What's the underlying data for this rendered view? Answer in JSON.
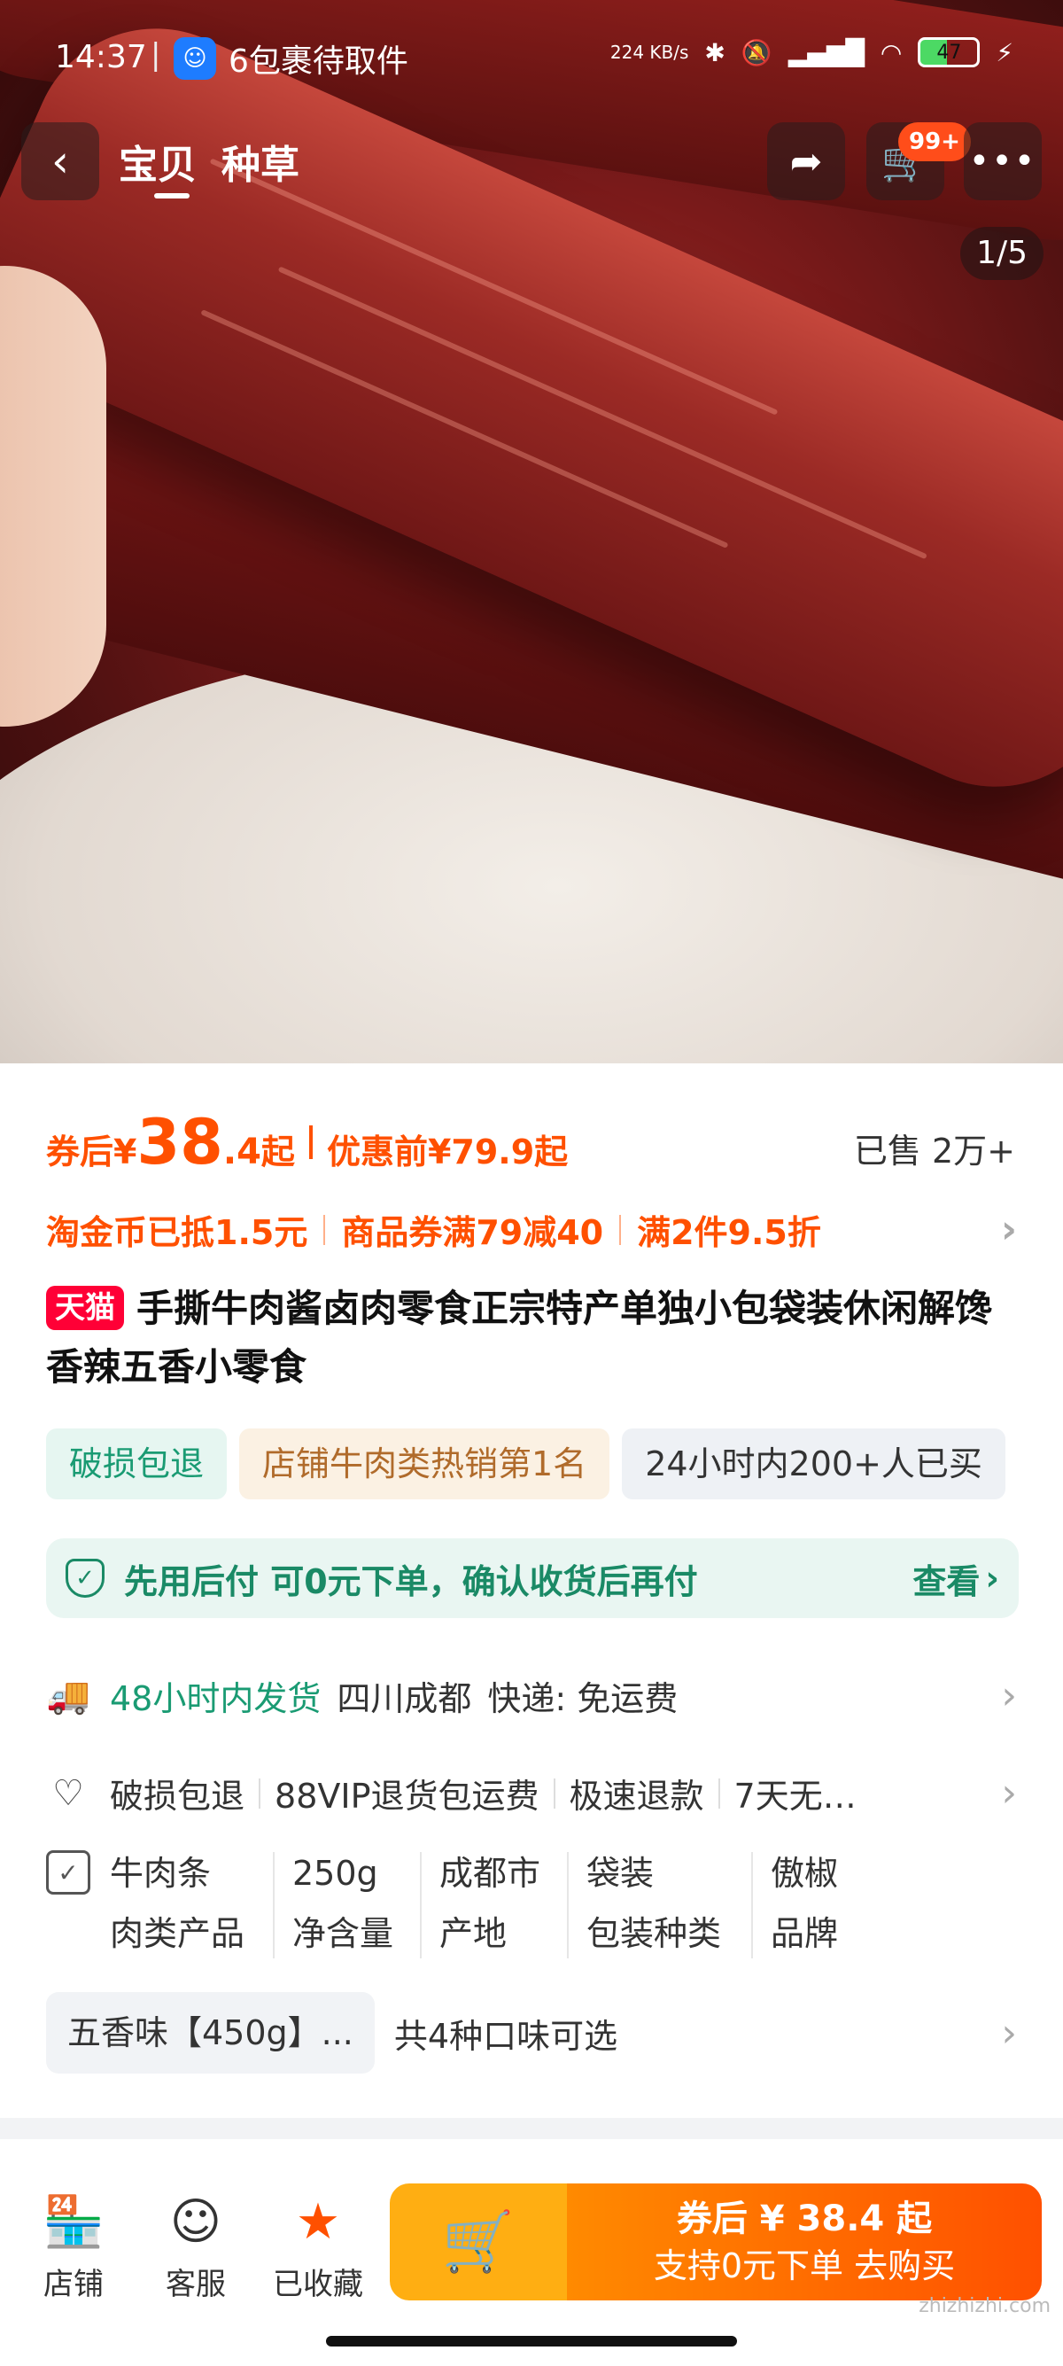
{
  "status_bar": {
    "time": "14:37",
    "notification": "6包裹待取件",
    "net_speed": "224 KB/s",
    "battery": "47"
  },
  "nav": {
    "tabs": [
      "宝贝",
      "种草"
    ],
    "cart_badge": "99+",
    "image_counter": "1/5"
  },
  "price": {
    "prefix": "券后",
    "currency": "¥",
    "amount_int": "38",
    "amount_dec": ".4",
    "suffix": "起",
    "before_label": "优惠前",
    "before_price": "¥79.9",
    "before_suffix": "起",
    "sold": "已售 2万+"
  },
  "promos": [
    "淘金币已抵1.5元",
    "商品券满79减40",
    "满2件9.5折"
  ],
  "product": {
    "badge": "天猫",
    "title": "手撕牛肉酱卤肉零食正宗特产单独小包袋装休闲解馋香辣五香小零食"
  },
  "tags": [
    "破损包退",
    "店铺牛肉类热销第1名",
    "24小时内200+人已买"
  ],
  "pay_later": {
    "text": "先用后付 可0元下单，确认收货后再付",
    "link": "查看"
  },
  "shipping": {
    "time": "48小时内发货",
    "origin": "四川成都",
    "express": "快递: 免运费"
  },
  "services": [
    "破损包退",
    "88VIP退货包运费",
    "极速退款",
    "7天无…"
  ],
  "attributes": [
    {
      "value": "牛肉条",
      "key": "肉类产品"
    },
    {
      "value": "250g",
      "key": "净含量"
    },
    {
      "value": "成都市",
      "key": "产地"
    },
    {
      "value": "袋装",
      "key": "包装种类"
    },
    {
      "value": "傲椒",
      "key": "品牌"
    }
  ],
  "flavor": {
    "selected": "五香味【450g】...",
    "more": "共4种口味可选"
  },
  "bottom_bar": {
    "shop": "店铺",
    "service": "客服",
    "collected": "已收藏",
    "buy_line1": "券后 ¥ 38.4 起",
    "buy_line2": "支持0元下单  去购买"
  },
  "watermark": "zhizhizhi.com",
  "colors": {
    "accent": "#ff5000",
    "tmall": "#ff0036",
    "green": "#1a9b73",
    "cart_button": "#ffae12"
  }
}
